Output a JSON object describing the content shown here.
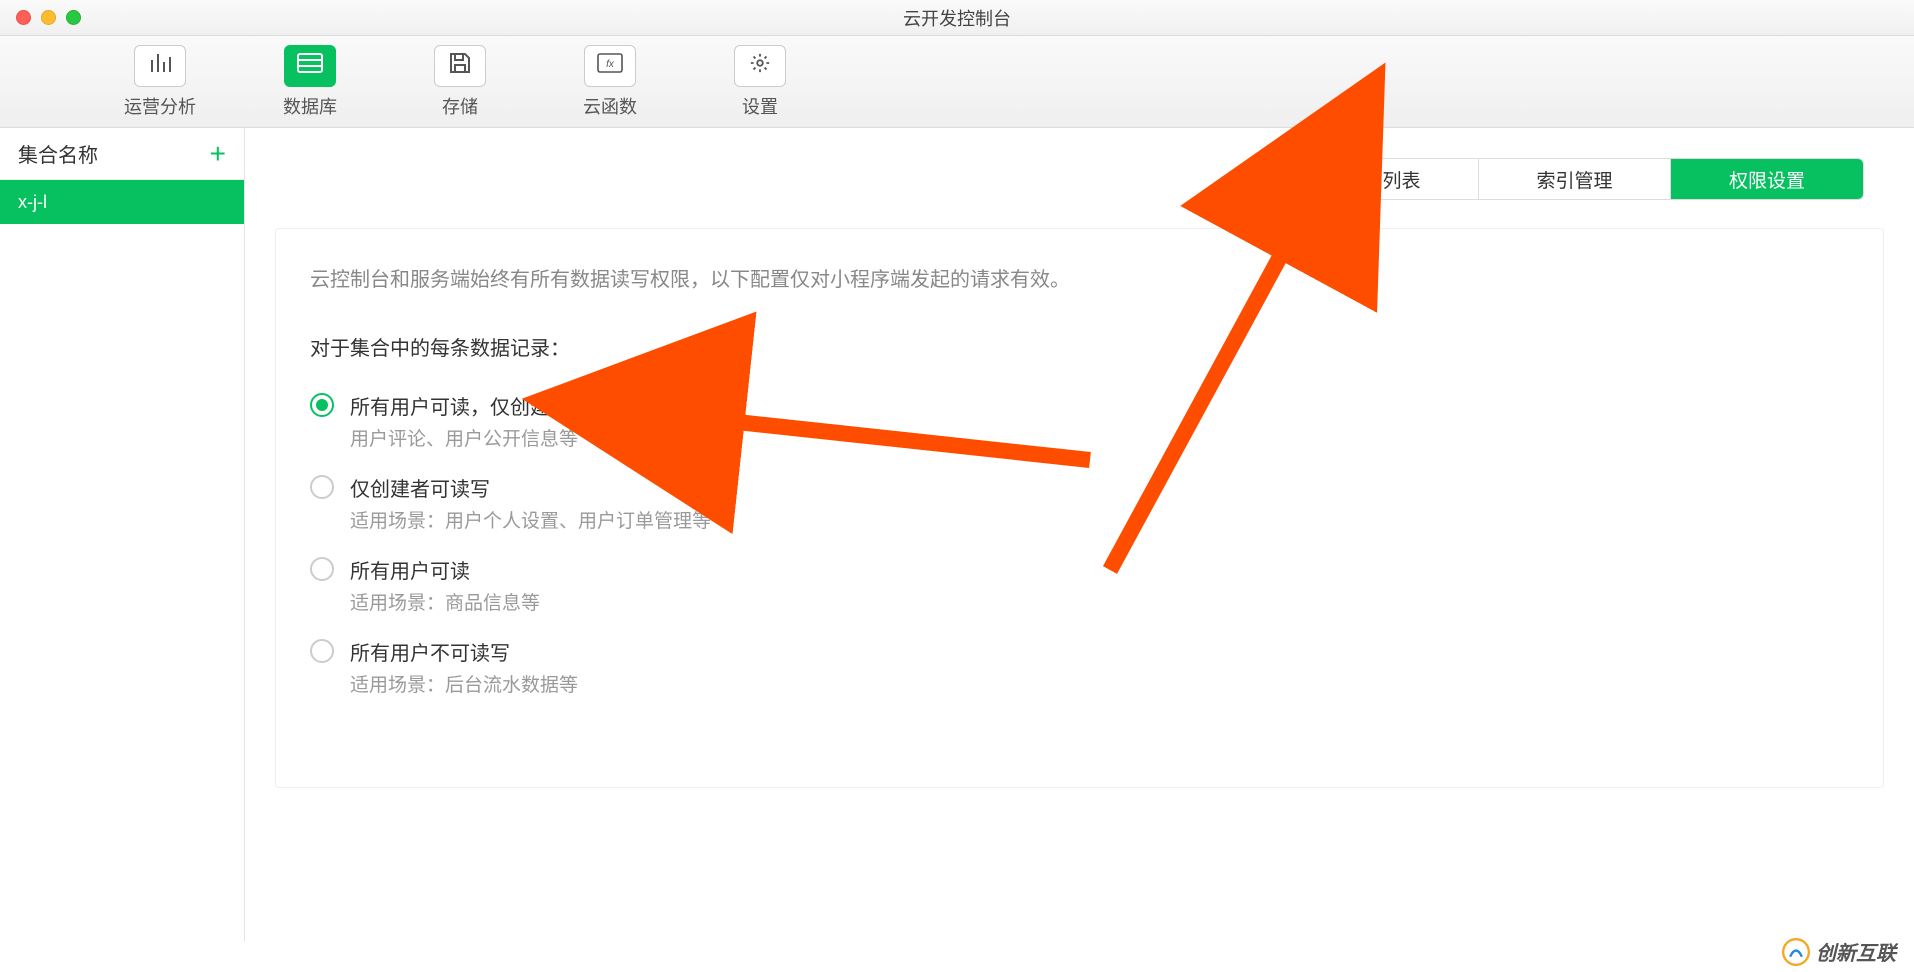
{
  "window": {
    "title": "云开发控制台"
  },
  "toolbar": {
    "items": [
      {
        "label": "运营分析",
        "icon": "bars",
        "active": false
      },
      {
        "label": "数据库",
        "icon": "db",
        "active": true
      },
      {
        "label": "存储",
        "icon": "save",
        "active": false
      },
      {
        "label": "云函数",
        "icon": "fx",
        "active": false
      },
      {
        "label": "设置",
        "icon": "gear",
        "active": false
      }
    ]
  },
  "sidebar": {
    "title": "集合名称",
    "add_label": "+",
    "items": [
      {
        "name": "x-j-l",
        "active": true
      }
    ]
  },
  "tabs": {
    "items": [
      {
        "label": "记录列表",
        "active": false
      },
      {
        "label": "索引管理",
        "active": false
      },
      {
        "label": "权限设置",
        "active": true
      }
    ]
  },
  "panel": {
    "description": "云控制台和服务端始终有所有数据读写权限，以下配置仅对小程序端发起的请求有效。",
    "subhead": "对于集合中的每条数据记录：",
    "options": [
      {
        "title": "所有用户可读，仅创建者可读写",
        "sub": "用户评论、用户公开信息等",
        "selected": true
      },
      {
        "title": "仅创建者可读写",
        "sub": "适用场景：用户个人设置、用户订单管理等",
        "selected": false
      },
      {
        "title": "所有用户可读",
        "sub": "适用场景：商品信息等",
        "selected": false
      },
      {
        "title": "所有用户不可读写",
        "sub": "适用场景：后台流水数据等",
        "selected": false
      }
    ]
  },
  "watermark": {
    "text": "创新互联"
  }
}
